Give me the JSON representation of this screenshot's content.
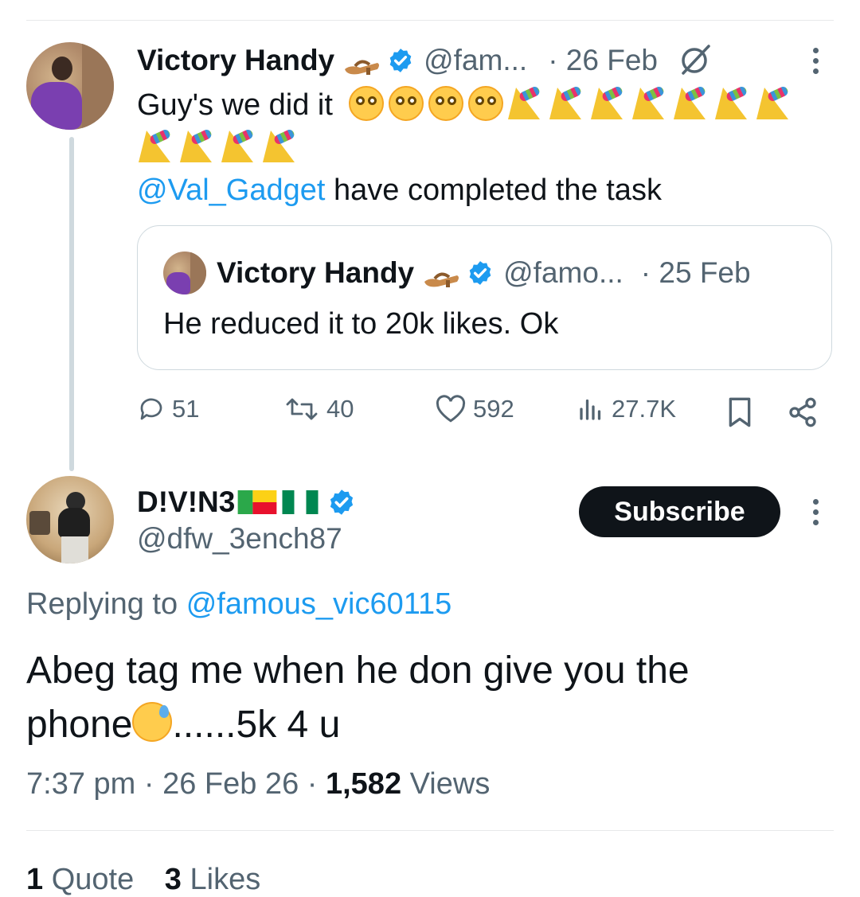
{
  "main_tweet": {
    "author_name": "Victory Handy",
    "author_handle": "@fam...",
    "date": "· 26 Feb",
    "text_line1": "Guy's we did it",
    "mention": "@Val_Gadget",
    "text_after_mention": "have completed the task"
  },
  "quoted_tweet": {
    "author_name": "Victory Handy",
    "author_handle": "@famo...",
    "date": "· 25 Feb",
    "text": "He reduced it to 20k likes. Ok"
  },
  "actions": {
    "replies": "51",
    "reposts": "40",
    "likes": "592",
    "views": "27.7K"
  },
  "reply_tweet": {
    "author_name": "D!V!N3",
    "author_handle": "@dfw_3ench87",
    "subscribe_label": "Subscribe",
    "replying_prefix": "Replying to",
    "replying_handle": "@famous_vic60115",
    "text_line1": "Abeg tag me when he don give you the",
    "text_line2_a": "phone",
    "text_line2_b": "......5k 4 u",
    "time": "7:37 pm · 26 Feb 26 ·",
    "views_count": "1,582",
    "views_label": "Views"
  },
  "stats": {
    "quotes_count": "1",
    "quotes_label": "Quote",
    "likes_count": "3",
    "likes_label": "Likes"
  },
  "colors": {
    "accent_blue": "#1d9bf0",
    "text_primary": "#0f1419",
    "text_secondary": "#536471",
    "border": "#cfd9de"
  },
  "icons": [
    "sandal-icon",
    "verified-badge-icon",
    "grok-icon",
    "more-icon",
    "reply-icon",
    "repost-icon",
    "like-icon",
    "views-icon",
    "bookmark-icon",
    "share-icon"
  ]
}
